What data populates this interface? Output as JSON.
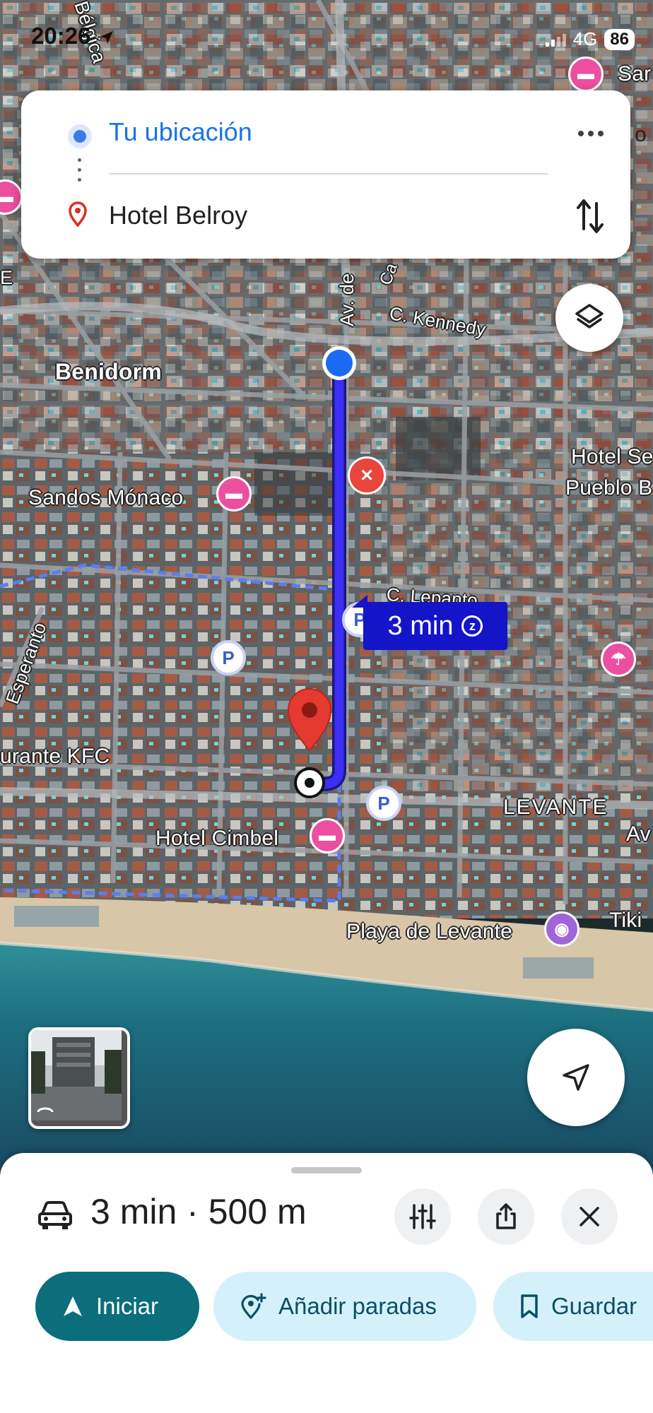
{
  "status_bar": {
    "time": "20:26",
    "network": "4G",
    "battery": "86"
  },
  "route_card": {
    "origin": "Tu ubicación",
    "destination": "Hotel Belroy"
  },
  "map": {
    "labels": {
      "belgica": "Bélgica",
      "sar": "Sar",
      "o": "o",
      "e": "E",
      "av_de": "Av. de",
      "ca": "Ca",
      "kennedy": "C. Kennedy",
      "benidorm": "Benidorm",
      "hotel_se": "Hotel Se",
      "pueblo": "Pueblo B",
      "sandos": "Sandos Mónaco",
      "lepanto": "C. Lepanto",
      "esperanto": "Esperanto",
      "kfc": "urante KFC",
      "levante_area": "LEVANTE",
      "av": "Av",
      "cimbel": "Hotel Cimbel",
      "playa": "Playa de Levante",
      "tiki": "Tiki"
    },
    "route_eta": "3 min",
    "parking": "P"
  },
  "sheet": {
    "duration": "3 min",
    "separator": "·",
    "distance": "500 m",
    "start_label": "Iniciar",
    "add_stops_label": "Añadir paradas",
    "save_label": "Guardar"
  }
}
